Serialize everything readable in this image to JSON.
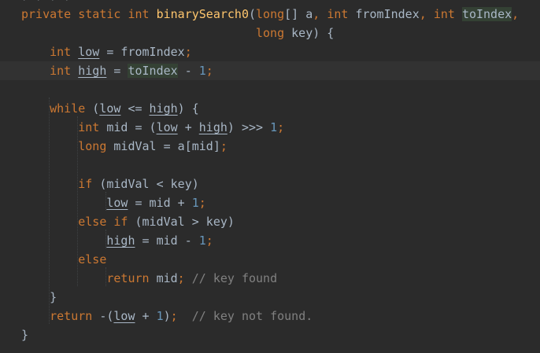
{
  "editor": {
    "partial_top_line": ", , , ,",
    "lines": [
      "private static int binarySearch0(long[] a, int fromIndex, int toIndex,",
      "long key) {",
      "int low = fromIndex;",
      "int high = toIndex - 1;",
      "",
      "while (low <= high) {",
      "int mid = (low + high) >>> 1;",
      "long midVal = a[mid];",
      "",
      "if (midVal < key)",
      "low = mid + 1;",
      "else if (midVal > key)",
      "high = mid - 1;",
      "else",
      "return mid; // key found",
      "}",
      "return -(low + 1);  // key not found.",
      "}"
    ],
    "current_line_index": 3,
    "highlighted_identifier": "toIndex",
    "colors": {
      "background": "#2b2b2b",
      "current_line": "#323232",
      "keyword": "#cc7832",
      "method_declaration": "#ffc66d",
      "number": "#6897bb",
      "comment": "#808080",
      "default_text": "#a9b7c6",
      "identifier_highlight": "#344134"
    }
  }
}
